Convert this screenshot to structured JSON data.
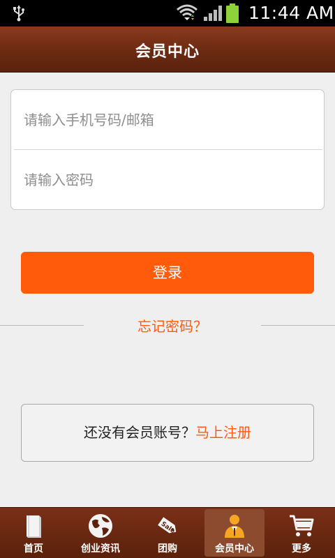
{
  "status_bar": {
    "time": "11:44 AM",
    "icons": [
      "usb-icon",
      "wifi-icon",
      "signal-icon",
      "battery-icon"
    ]
  },
  "header": {
    "title": "会员中心"
  },
  "login_form": {
    "phone_placeholder": "请输入手机号码/邮箱",
    "phone_value": "",
    "password_placeholder": "请输入密码",
    "password_value": "",
    "login_label": "登录",
    "forgot_label": "忘记密码？"
  },
  "register": {
    "prompt": "还没有会员账号？",
    "link": "马上注册"
  },
  "bottom_nav": {
    "items": [
      {
        "label": "首页",
        "icon": "book-icon"
      },
      {
        "label": "创业资讯",
        "icon": "globe-icon"
      },
      {
        "label": "团购",
        "icon": "sale-tag-icon"
      },
      {
        "label": "会员中心",
        "icon": "member-icon",
        "active": true
      },
      {
        "label": "更多",
        "icon": "cart-icon"
      }
    ]
  },
  "colors": {
    "accent": "#ff5b0b",
    "header": "#6b2a12",
    "background": "#efefef"
  }
}
